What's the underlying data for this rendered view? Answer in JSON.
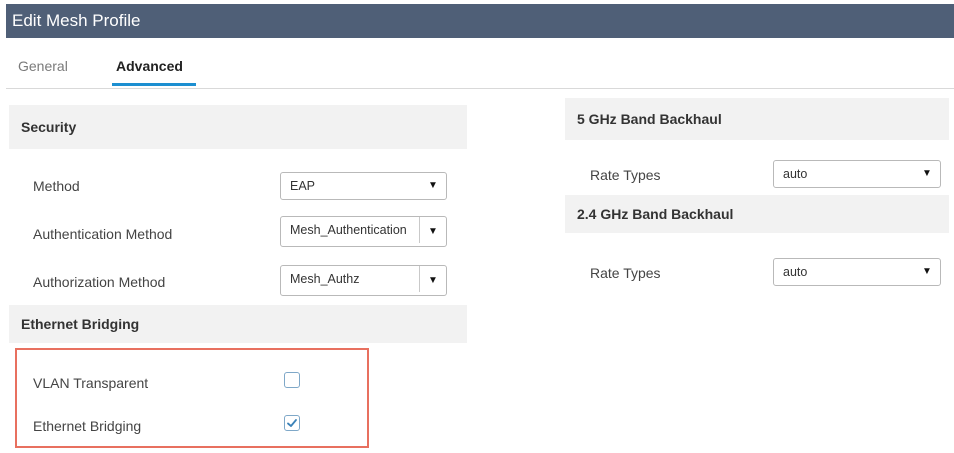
{
  "window": {
    "title": "Edit Mesh Profile"
  },
  "tabs": [
    {
      "label": "General",
      "active": false
    },
    {
      "label": "Advanced",
      "active": true
    }
  ],
  "security": {
    "heading": "Security",
    "method": {
      "label": "Method",
      "value": "EAP"
    },
    "authentication_method": {
      "label": "Authentication Method",
      "value": "Mesh_Authentication"
    },
    "authorization_method": {
      "label": "Authorization Method",
      "value": "Mesh_Authz"
    }
  },
  "ethernet_bridging": {
    "heading": "Ethernet Bridging",
    "vlan_transparent": {
      "label": "VLAN Transparent",
      "checked": false
    },
    "ethernet_bridging": {
      "label": "Ethernet Bridging",
      "checked": true
    }
  },
  "band_5ghz": {
    "heading": "5 GHz Band Backhaul",
    "rate_types": {
      "label": "Rate Types",
      "value": "auto"
    }
  },
  "band_24ghz": {
    "heading": "2.4 GHz Band Backhaul",
    "rate_types": {
      "label": "Rate Types",
      "value": "auto"
    }
  },
  "colors": {
    "titlebar": "#4f5f77",
    "tab_accent": "#1c8fd1",
    "highlight_border": "#e8705f",
    "checkbox_border": "#7fa8c8"
  },
  "icons": {
    "dropdown": "caret-down-icon",
    "check": "checkmark-icon"
  }
}
